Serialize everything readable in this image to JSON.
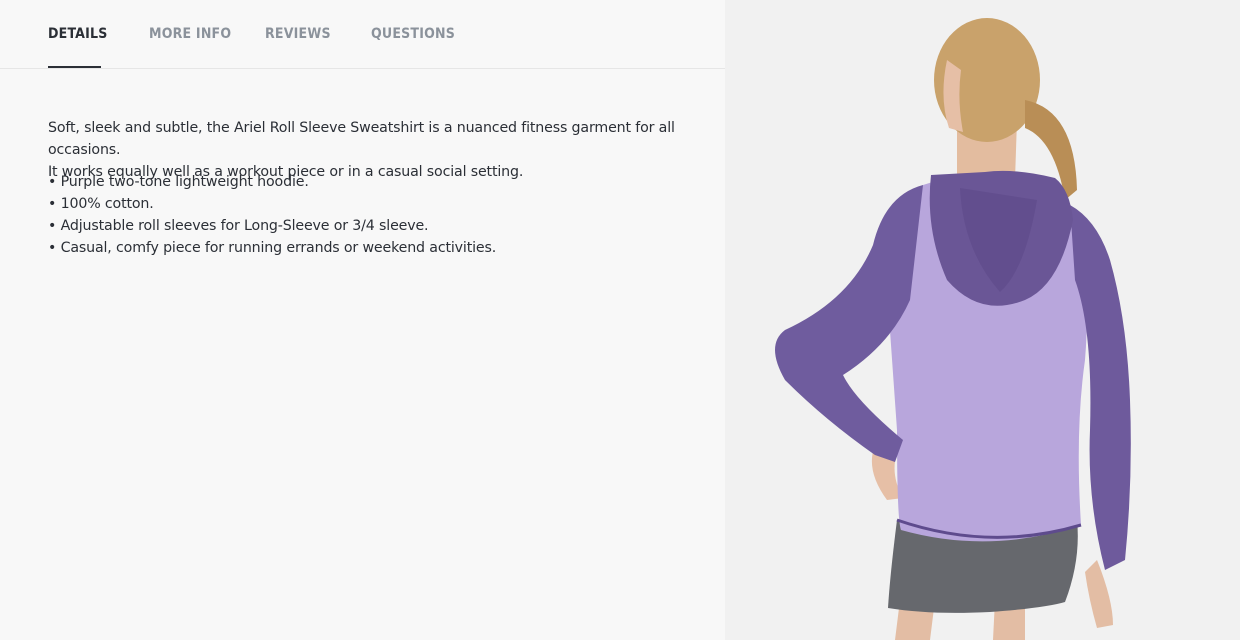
{
  "tabs": [
    {
      "label": "DETAILS",
      "active": true
    },
    {
      "label": "MORE INFO",
      "active": false
    },
    {
      "label": "REVIEWS",
      "active": false
    },
    {
      "label": "QUESTIONS",
      "active": false
    }
  ],
  "details": {
    "description_line1": "Soft, sleek and subtle, the Ariel Roll Sleeve Sweatshirt is a nuanced fitness garment for all occasions.",
    "description_line2": "It works equally well as a workout piece or in a casual social setting.",
    "features": [
      "• Purple two-tone lightweight hoodie.",
      "• 100% cotton.",
      "• Adjustable roll sleeves for Long-Sleeve or 3/4 sleeve.",
      "• Casual, comfy piece for running errands or weekend activities."
    ]
  },
  "product_image": {
    "subject": "woman-back-view-purple-hoodie",
    "colors": {
      "background": "#f1f1f1",
      "body": "#b7a6dc",
      "sleeves": "#6e5a9c",
      "hood": "#6a5696",
      "shorts": "#6a6c70",
      "skin": "#e6bfa6",
      "hair": "#c9a26b"
    }
  }
}
